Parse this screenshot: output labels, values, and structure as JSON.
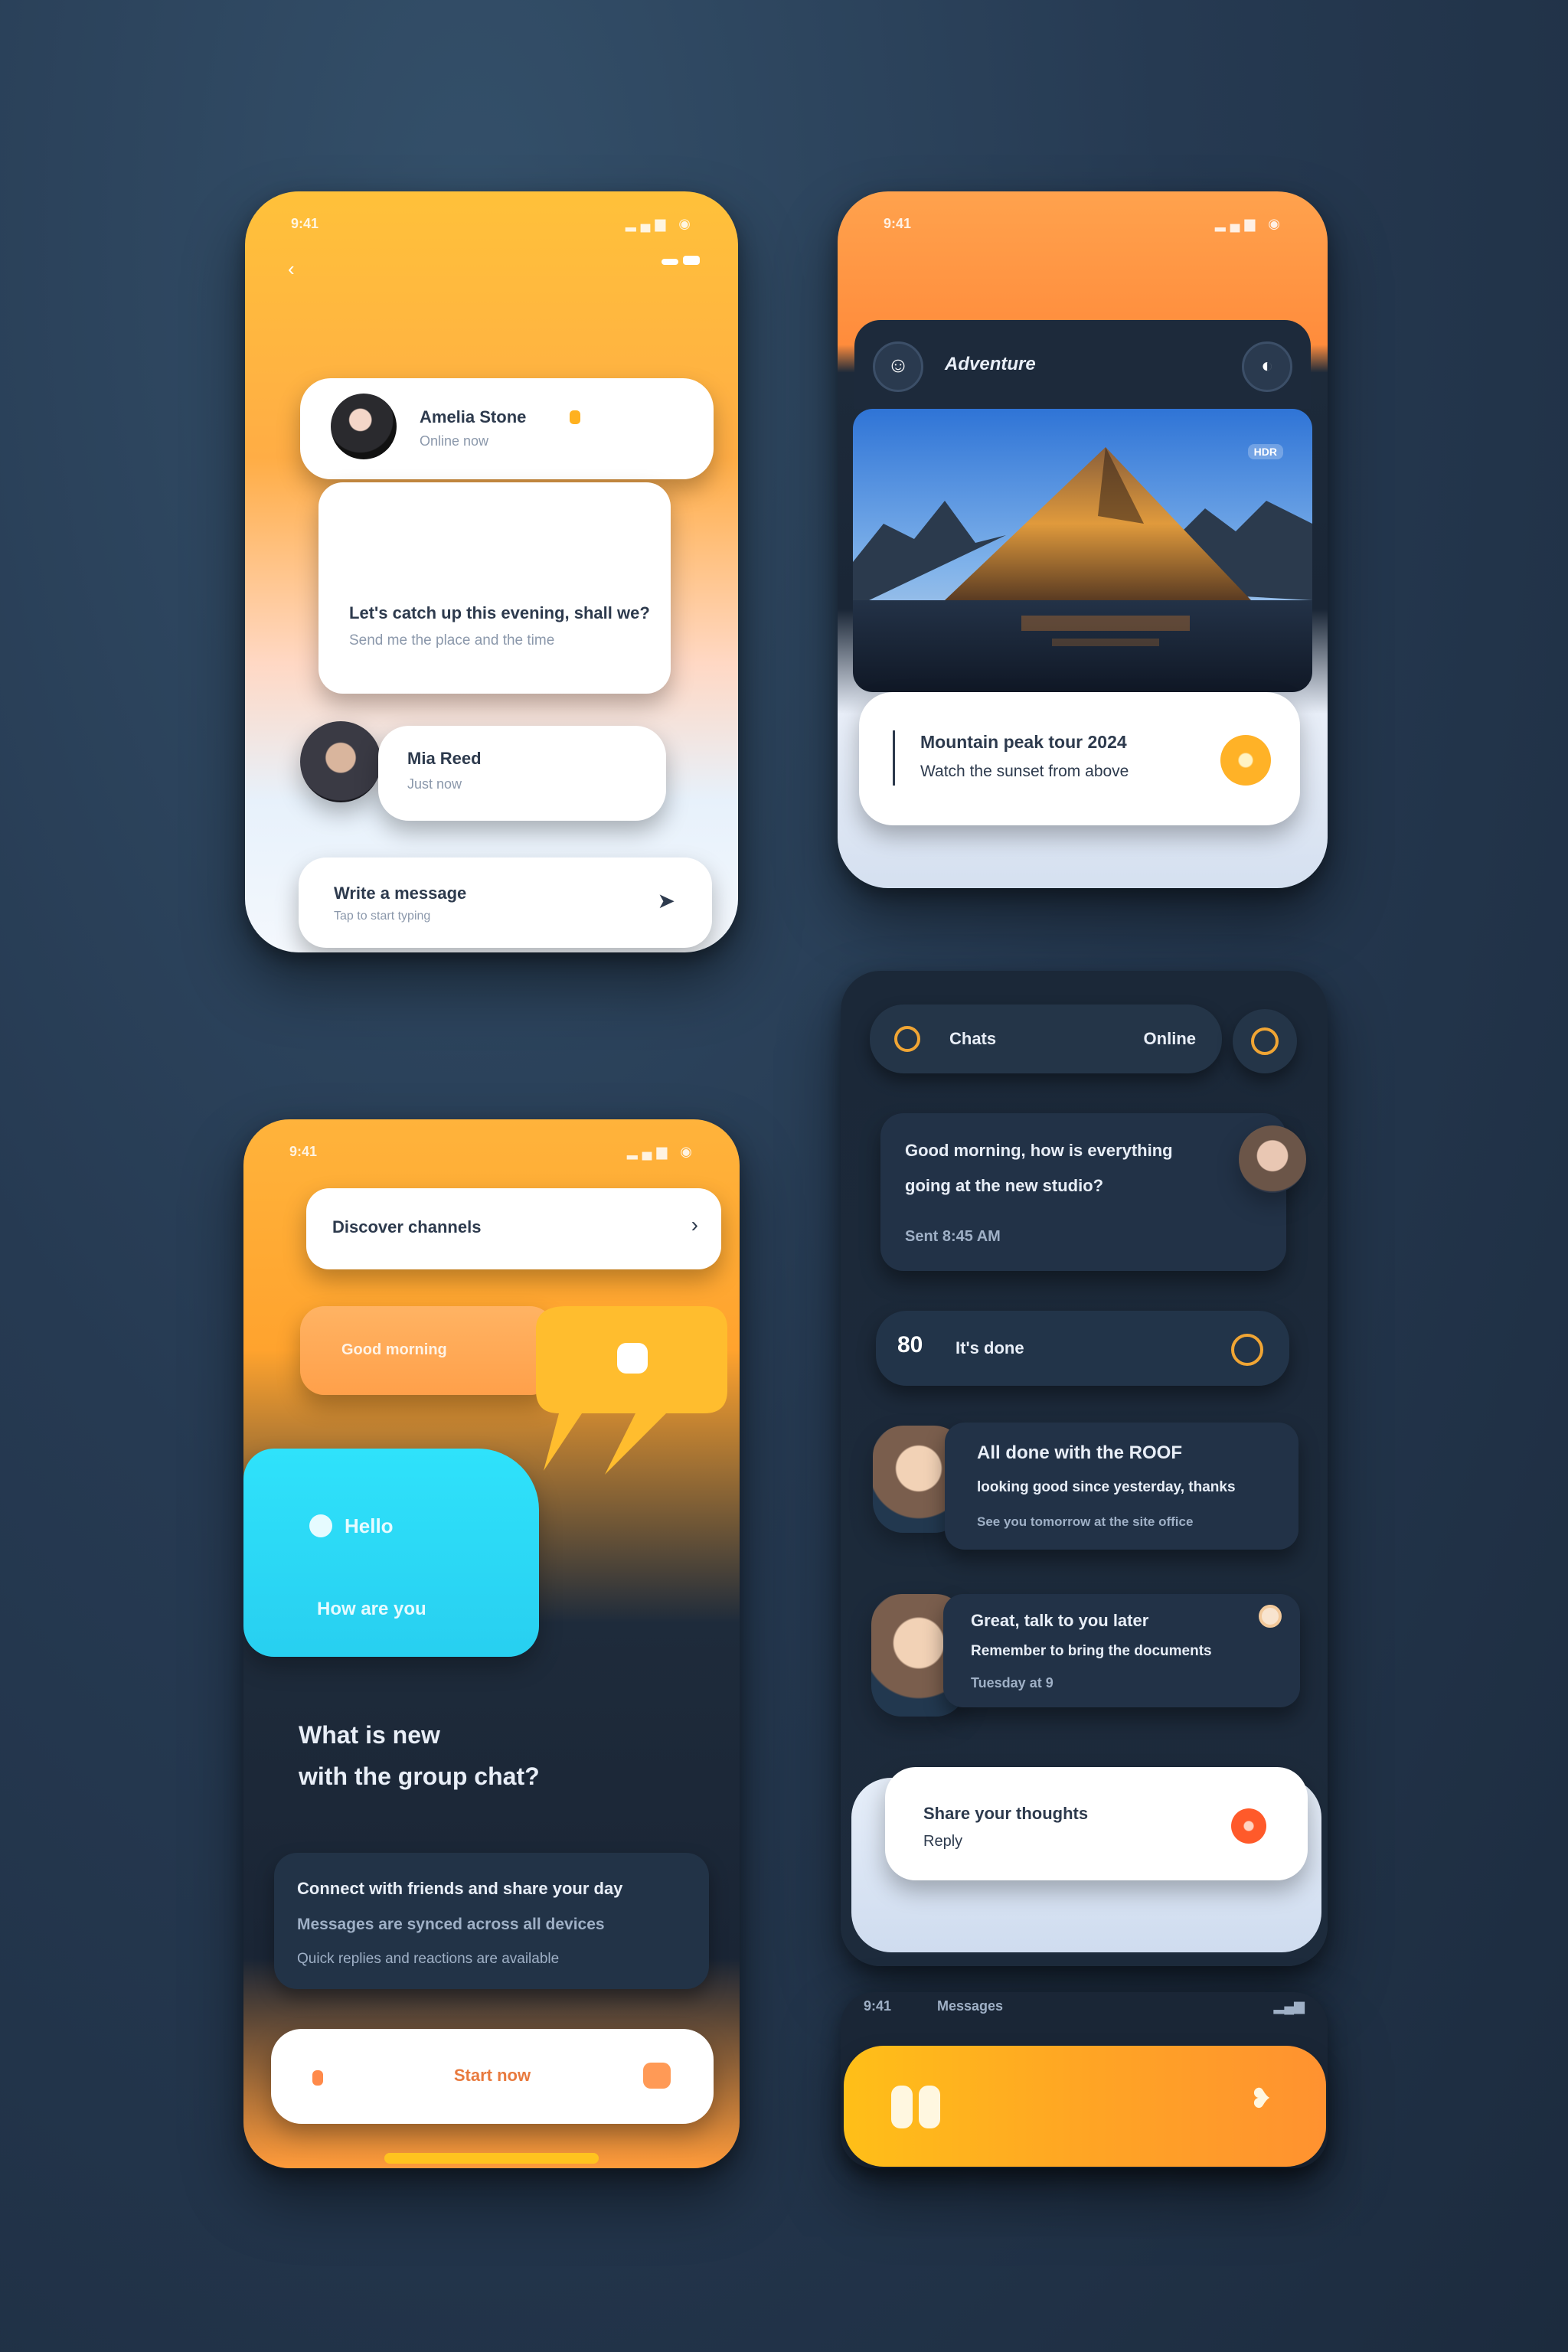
{
  "phone1": {
    "status_time": "9:41",
    "status_icons": "▂▄▆ ◉",
    "header_icon_left": "chevron-left-icon",
    "header_icon_right": "menu-icon",
    "contact": {
      "name": "Amelia Stone",
      "subtitle": "Online now",
      "badge_color": "#ffb11f"
    },
    "message_text_1": "Let's catch up this evening, shall we?",
    "message_text_2": "Send me the place and the time",
    "reply": {
      "name": "Mia Reed",
      "subtitle": "Just now"
    },
    "input": {
      "placeholder": "Write a message",
      "hint": "Tap to start typing"
    },
    "send_icon": "send-icon"
  },
  "phone2": {
    "status_time": "9:41",
    "status_icons": "▂▄▆ ◉",
    "header_title": "Adventure",
    "header_left_icon": "user-icon",
    "header_right_icon": "profile-icon",
    "photo_badge": "HDR",
    "card_title": "Mountain peak tour 2024",
    "card_subtitle": "Watch the sunset from above",
    "card_button_icon": "play-icon"
  },
  "phone3": {
    "status_time": "9:41",
    "status_icons": "▂▄▆ ◉",
    "top_input": "Discover channels",
    "top_input_icon": "chevron-right-icon",
    "chip_label": "Good morning",
    "bubble_cyan_line1": "Hello",
    "bubble_cyan_line2": "How are you",
    "question_line1": "What is new",
    "question_line2": "with the group chat?",
    "paragraph_line1": "Connect with friends and share your day",
    "paragraph_line2": "Messages are synced across all devices",
    "paragraph_line3": "Quick replies and reactions are available",
    "bottom_button": "Start now"
  },
  "panel4": {
    "top_bar_left": "Chats",
    "top_bar_right": "Online",
    "msg1_line1": "Good morning, how is everything",
    "msg1_line2": "going at the new studio?",
    "msg1_line3": "Sent 8:45 AM",
    "pill": {
      "icon_label": "80",
      "text": "It's done",
      "icon": "clock-icon"
    },
    "msg2_line1": "All done with the ROOF",
    "msg2_line2": "looking good since yesterday, thanks",
    "msg2_line3": "See you tomorrow at the site office",
    "msg3_line1": "Great, talk to you later",
    "msg3_line2": "Remember to bring the documents",
    "msg3_line3": "Tuesday at 9",
    "compose": {
      "line1": "Share your thoughts",
      "line2": "Reply"
    },
    "compose_icon": "record-icon"
  },
  "panel5": {
    "status_left": "9:41",
    "status_mid": "Messages",
    "status_right": "▂▄▆",
    "bar_left_icon": "pause-icon",
    "bar_right_icon": "heart-icon"
  },
  "colors": {
    "orange": "#ffa33a",
    "yellow": "#ffc232",
    "cyan": "#2bdcf6",
    "navy": "#1c2839",
    "white": "#ffffff"
  }
}
